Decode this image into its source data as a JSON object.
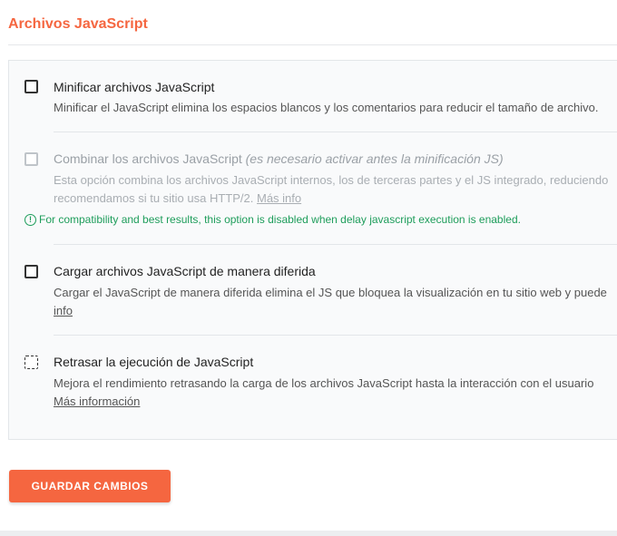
{
  "section": {
    "title": "Archivos JavaScript"
  },
  "options": [
    {
      "label": "Minificar archivos JavaScript",
      "description_line1": "Minificar el JavaScript elimina los espacios blancos y los comentarios para reducir el tamaño de archivo.",
      "checked": false,
      "disabled": false
    },
    {
      "label": "Combinar los archivos JavaScript",
      "label_italic": "(es necesario activar antes la minificación JS)",
      "description_line1": "Esta opción combina los archivos JavaScript internos, los de terceras partes y el JS integrado, reduciendo",
      "description_line2": "recomendamos si tu sitio usa HTTP/2.",
      "link": "Más info",
      "notice": "For compatibility and best results, this option is disabled when delay javascript execution is enabled.",
      "checked": false,
      "disabled": true
    },
    {
      "label": "Cargar archivos JavaScript de manera diferida",
      "description_line1": "Cargar el JavaScript de manera diferida elimina el JS que bloquea la visualización en tu sitio web y puede",
      "link": "info",
      "checked": false,
      "disabled": false
    },
    {
      "label": "Retrasar la ejecución de JavaScript",
      "description_line1": "Mejora el rendimiento retrasando la carga de los archivos JavaScript hasta la interacción con el usuario",
      "link": "Más información",
      "checked": false,
      "disabled": false
    }
  ],
  "save_button": {
    "label": "GUARDAR CAMBIOS"
  },
  "colors": {
    "accent": "#f56640",
    "notice": "#1e9d5b"
  }
}
